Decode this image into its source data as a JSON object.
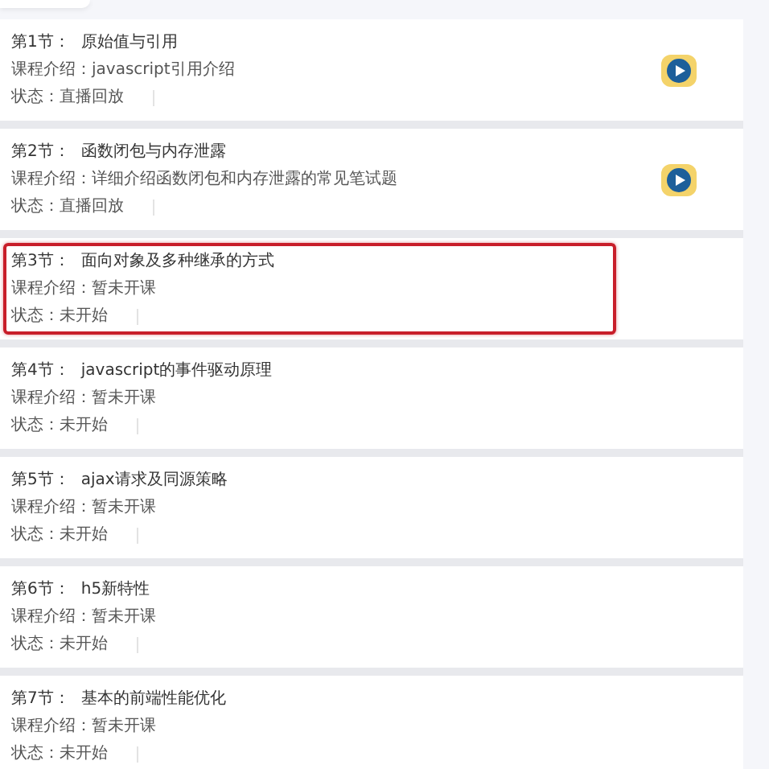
{
  "lessons": [
    {
      "number": "第1节：",
      "title": "原始值与引用",
      "intro_label": "课程介绍：",
      "intro": "javascript引用介绍",
      "status_label": "状态：",
      "status": "直播回放",
      "playable": true,
      "highlighted": false
    },
    {
      "number": "第2节：",
      "title": "函数闭包与内存泄露",
      "intro_label": "课程介绍：",
      "intro": "详细介绍函数闭包和内存泄露的常见笔试题",
      "status_label": "状态：",
      "status": "直播回放",
      "playable": true,
      "highlighted": false
    },
    {
      "number": "第3节：",
      "title": "面向对象及多种继承的方式",
      "intro_label": "课程介绍：",
      "intro": "暂未开课",
      "status_label": "状态：",
      "status": "未开始",
      "playable": false,
      "highlighted": true
    },
    {
      "number": "第4节：",
      "title": "javascript的事件驱动原理",
      "intro_label": "课程介绍：",
      "intro": "暂未开课",
      "status_label": "状态：",
      "status": "未开始",
      "playable": false,
      "highlighted": false
    },
    {
      "number": "第5节：",
      "title": "ajax请求及同源策略",
      "intro_label": "课程介绍：",
      "intro": "暂未开课",
      "status_label": "状态：",
      "status": "未开始",
      "playable": false,
      "highlighted": false
    },
    {
      "number": "第6节：",
      "title": "h5新特性",
      "intro_label": "课程介绍：",
      "intro": "暂未开课",
      "status_label": "状态：",
      "status": "未开始",
      "playable": false,
      "highlighted": false
    },
    {
      "number": "第7节：",
      "title": "基本的前端性能优化",
      "intro_label": "课程介绍：",
      "intro": "暂未开课",
      "status_label": "状态：",
      "status": "未开始",
      "playable": false,
      "highlighted": false
    }
  ]
}
